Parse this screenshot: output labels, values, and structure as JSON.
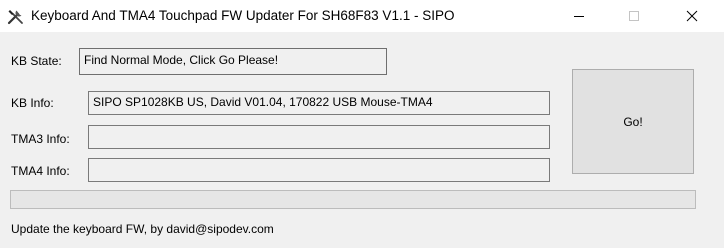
{
  "window": {
    "title": "Keyboard And TMA4 Touchpad FW Updater For SH68F83 V1.1 - SIPO",
    "icon": "tools-icon"
  },
  "kb_state": {
    "label": "KB State:",
    "value": "Find Normal Mode, Click Go Please!"
  },
  "kb_info": {
    "label": "KB Info:",
    "value": "SIPO SP1028KB US, David V01.04, 170822 USB Mouse-TMA4"
  },
  "tma3_info": {
    "label": "TMA3 Info:",
    "value": ""
  },
  "tma4_info": {
    "label": "TMA4 Info:",
    "value": ""
  },
  "go_button": {
    "label": "Go!"
  },
  "progress": {
    "value": 0
  },
  "status": {
    "text": "Update the keyboard FW, by david@sipodev.com"
  }
}
